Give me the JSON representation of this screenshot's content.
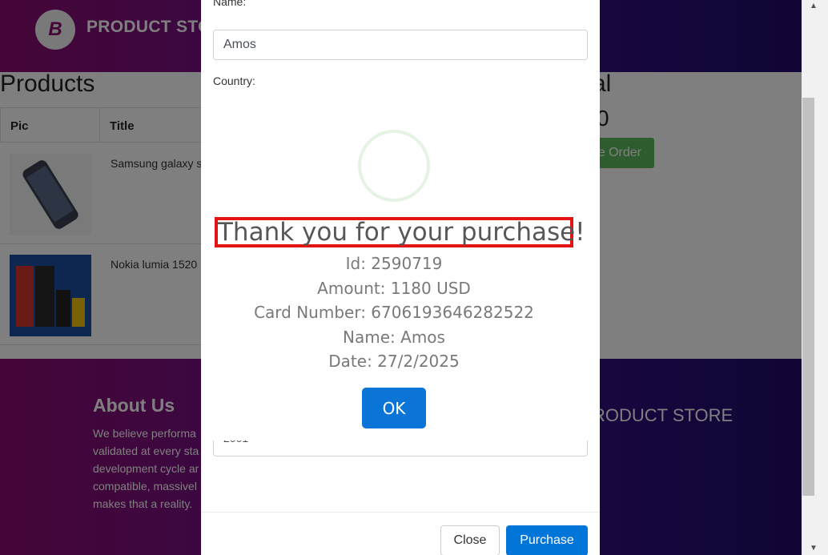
{
  "navbar": {
    "brand": "PRODUCT STORE",
    "logo_letter": "B"
  },
  "products": {
    "title": "Products",
    "columns": [
      "Pic",
      "Title"
    ],
    "rows": [
      {
        "title": "Samsung galaxy s"
      },
      {
        "title": "Nokia lumia 1520"
      }
    ]
  },
  "cart": {
    "total_title": "al",
    "total_amount": "0",
    "place_order_label": "e Order"
  },
  "footer": {
    "about_title": "About Us",
    "about_text": [
      "We believe performa",
      "validated at every sta",
      "development cycle ar",
      "compatible, massivel",
      "makes that a reality."
    ],
    "brand": "RODUCT STORE"
  },
  "order_modal": {
    "name_label": "Name:",
    "name_value": "Amos",
    "country_label": "Country:",
    "year_value": "2001",
    "close_label": "Close",
    "purchase_label": "Purchase"
  },
  "alert": {
    "title": "Thank you for your purchase!",
    "id_line": "Id: 2590719",
    "amount_line": "Amount: 1180 USD",
    "card_line": "Card Number: 6706193646282522",
    "name_line": "Name: Amos",
    "date_line": "Date: 27/2/2025",
    "ok_label": "OK"
  },
  "colors": {
    "accent": "#0a75d6",
    "highlight": "#e21414",
    "success": "#5cb85c"
  }
}
